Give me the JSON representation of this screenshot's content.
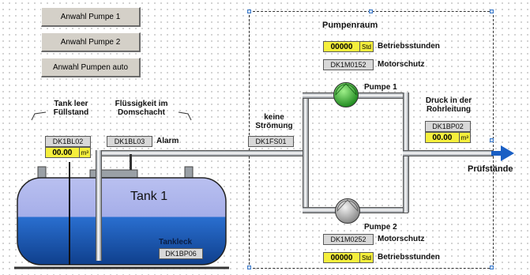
{
  "buttons": {
    "pump1": "Anwahl Pumpe 1",
    "pump2": "Anwahl Pumpe 2",
    "auto": "Anwahl Pumpen auto"
  },
  "pumpenraum": {
    "title": "Pumpenraum",
    "hours1": {
      "value": "00000",
      "unit": "Std",
      "label": "Betriebsstunden"
    },
    "motor1": {
      "tag": "DK1M0152",
      "label": "Motorschutz"
    },
    "pump1_label": "Pumpe 1",
    "pump2_label": "Pumpe 2",
    "motor2": {
      "tag": "DK1M0252",
      "label": "Motorschutz"
    },
    "hours2": {
      "value": "00000",
      "unit": "Std",
      "label": "Betriebsstunden"
    }
  },
  "tank": {
    "name": "Tank 1",
    "level_low_label": "Tank leer Füllstand",
    "level_tag": "DK1BL02",
    "level_value": {
      "value": "00.00",
      "unit": "m³"
    },
    "liquid_label": "Flüssigkeit im Domschacht",
    "liquid_tag": "DK1BL03",
    "alarm_label": "Alarm",
    "leak_label": "Tankleck",
    "leak_tag": "DK1BP06",
    "liquid_fill_fraction": 0.55
  },
  "flow": {
    "label": "keine Strömung",
    "tag": "DK1FS01"
  },
  "pressure": {
    "label": "Druck in der Rohrleitung",
    "tag": "DK1BP02",
    "value": "00.00",
    "unit": "m³"
  },
  "outlet_label": "Prüfstände",
  "colors": {
    "tank_top": "#9aa3e6",
    "tank_liquid": "#1d5fb8",
    "pump_running": "#2fa02f",
    "pump_stopped": "#bdbdbd",
    "value_bg": "#f5ef3c",
    "arrow": "#1a5fc4"
  }
}
